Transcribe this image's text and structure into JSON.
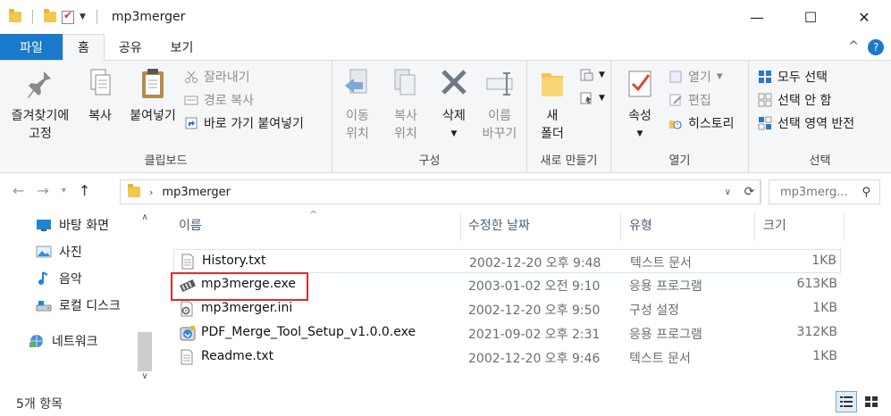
{
  "title_bar": {
    "title": "mp3merger",
    "minimize": "—",
    "maximize": "☐",
    "close": "✕"
  },
  "tabs": {
    "file": "파일",
    "home": "홈",
    "share": "공유",
    "view": "보기",
    "collapse_glyph": "^",
    "help_glyph": "?"
  },
  "ribbon": {
    "clipboard": {
      "label": "클립보드",
      "pin": [
        "즐겨찾기에",
        "고정"
      ],
      "copy": "복사",
      "paste": "붙여넣기",
      "cut": "잘라내기",
      "copy_path": "경로 복사",
      "paste_shortcut": "바로 가기 붙여넣기"
    },
    "organize": {
      "label": "구성",
      "move_to": [
        "이동",
        "위치"
      ],
      "copy_to": [
        "복사",
        "위치"
      ],
      "delete": "삭제",
      "rename": [
        "이름",
        "바꾸기"
      ]
    },
    "new": {
      "label": "새로 만들기",
      "new_folder": [
        "새",
        "폴더"
      ]
    },
    "open": {
      "label": "열기",
      "properties": "속성",
      "open": "열기",
      "edit": "편집",
      "history": "히스토리"
    },
    "select": {
      "label": "선택",
      "select_all": "모두 선택",
      "select_none": "선택 안 함",
      "invert": "선택 영역 반전"
    }
  },
  "address": {
    "path": "mp3merger",
    "search_placeholder": "mp3merg..."
  },
  "nav_pane": {
    "items": [
      {
        "label": "바탕 화면",
        "icon": "desktop-icon"
      },
      {
        "label": "사진",
        "icon": "pictures-icon"
      },
      {
        "label": "음악",
        "icon": "music-icon"
      },
      {
        "label": "로컬 디스크",
        "icon": "drive-icon"
      },
      {
        "label": "네트워크",
        "icon": "network-icon"
      }
    ]
  },
  "file_list": {
    "columns": [
      "이름",
      "수정한 날짜",
      "유형",
      "크기"
    ],
    "rows": [
      {
        "name": "History.txt",
        "date": "2002-12-20 오후 9:48",
        "type": "텍스트 문서",
        "size": "1KB",
        "icon": "text-file-icon"
      },
      {
        "name": "mp3merge.exe",
        "date": "2003-01-02 오전 9:10",
        "type": "응용 프로그램",
        "size": "613KB",
        "icon": "exe-icon"
      },
      {
        "name": "mp3merger.ini",
        "date": "2002-12-20 오후 9:50",
        "type": "구성 설정",
        "size": "1KB",
        "icon": "settings-file-icon"
      },
      {
        "name": "PDF_Merge_Tool_Setup_v1.0.0.exe",
        "date": "2021-09-02 오후 2:31",
        "type": "응용 프로그램",
        "size": "312KB",
        "icon": "installer-icon"
      },
      {
        "name": "Readme.txt",
        "date": "2002-12-20 오후 9:46",
        "type": "텍스트 문서",
        "size": "1KB",
        "icon": "text-file-icon"
      }
    ]
  },
  "status": {
    "item_count": "5개 항목"
  },
  "colors": {
    "file_tab": "#1979ca",
    "highlight": "#e12a2a",
    "folder": "#f3c64f"
  }
}
